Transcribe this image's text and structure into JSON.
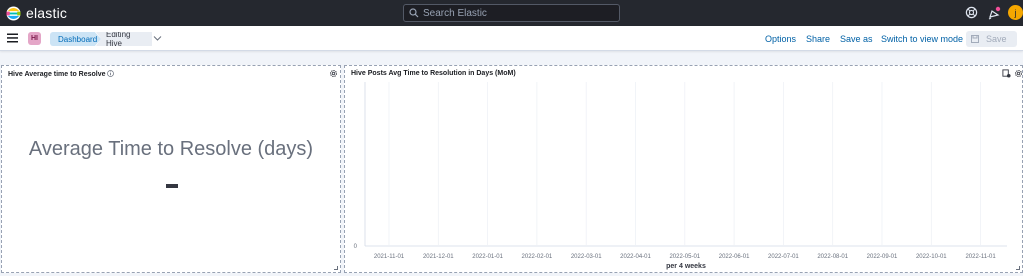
{
  "header": {
    "brand": "elastic",
    "search_placeholder": "Search Elastic",
    "user_initial": "j"
  },
  "toolbar": {
    "space_initials": "HI",
    "breadcrumbs": [
      "Dashboard",
      "Editing Hive"
    ],
    "actions": [
      "Options",
      "Share",
      "Save as",
      "Switch to view mode"
    ],
    "save_label": "Save"
  },
  "panels": {
    "left": {
      "title": "Hive Average time to Resolve",
      "metric_label": "Average Time to Resolve (days)",
      "metric_value": "-"
    },
    "right": {
      "title": "Hive Posts Avg Time to Resolution in Days (MoM)"
    }
  },
  "chart_data": {
    "type": "line",
    "title": "Hive Posts Avg Time to Resolution in Days (MoM)",
    "x": [
      "2021-11-01",
      "2021-12-01",
      "2022-01-01",
      "2022-02-01",
      "2022-03-01",
      "2022-04-01",
      "2022-05-01",
      "2022-06-01",
      "2022-07-01",
      "2022-08-01",
      "2022-09-01",
      "2022-10-01",
      "2022-11-01"
    ],
    "xlabel": "per 4 weeks",
    "ylabel": "",
    "y_ticks": [
      "0"
    ],
    "series": [],
    "grid": true
  },
  "colors": {
    "topbar": "#25282f",
    "link": "#0061a6",
    "accent": "#f5a700"
  }
}
